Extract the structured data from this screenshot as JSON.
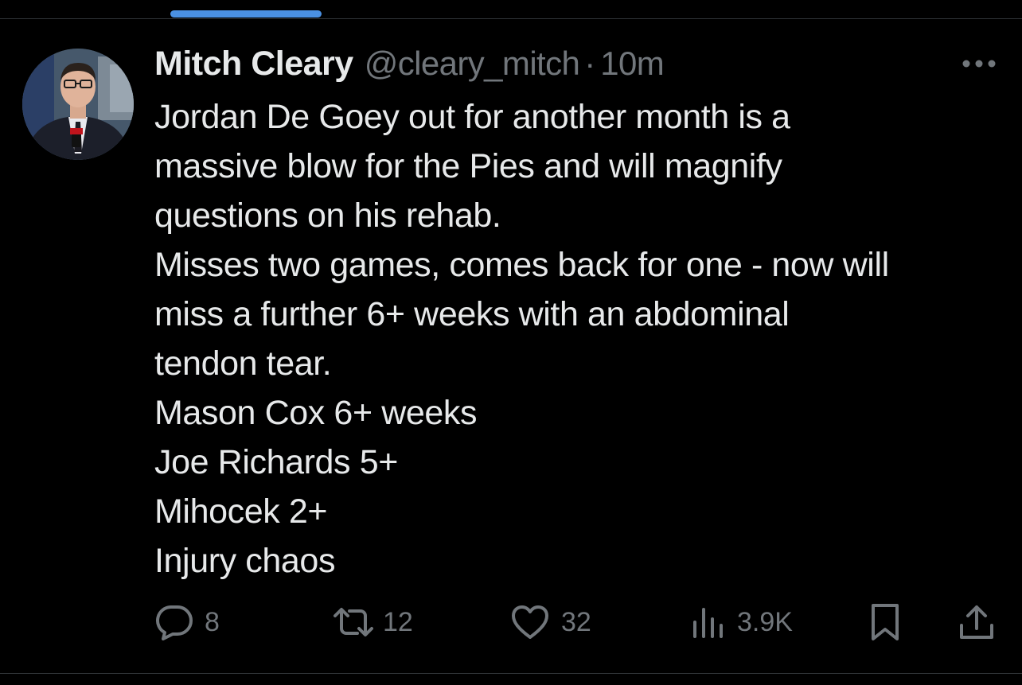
{
  "tweet": {
    "author_name": "Mitch Cleary",
    "handle": "@cleary_mitch",
    "separator": "·",
    "time": "10m",
    "lines": [
      "Jordan De Goey out for another month is a",
      "massive blow for the Pies and will magnify",
      "questions on his rehab.",
      "Misses two games, comes back for one - now will",
      "miss a further 6+ weeks with an abdominal",
      "tendon tear.",
      "Mason Cox 6+ weeks",
      "Joe Richards 5+",
      "Mihocek 2+",
      "Injury chaos"
    ]
  },
  "actions": {
    "replies": "8",
    "reposts": "12",
    "likes": "32",
    "views": "3.9K"
  },
  "icons": {
    "reply": "reply-icon",
    "repost": "repost-icon",
    "like": "heart-icon",
    "views": "views-icon",
    "bookmark": "bookmark-icon",
    "share": "share-icon",
    "more": "more-icon"
  },
  "colors": {
    "background": "#000000",
    "text": "#e7e9ea",
    "muted": "#71767b",
    "accent": "#4a90e2"
  }
}
